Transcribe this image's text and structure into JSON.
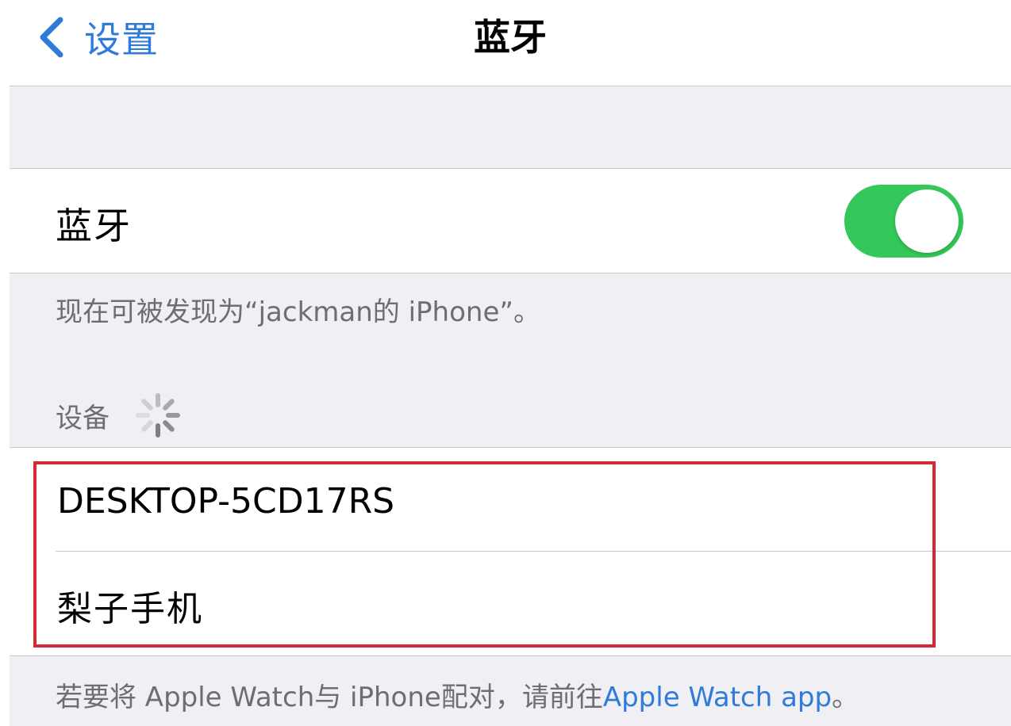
{
  "navbar": {
    "back_label": "设置",
    "title": "蓝牙"
  },
  "bluetooth": {
    "label": "蓝牙",
    "enabled": true,
    "toggle_color": "#34c759",
    "discoverable_text": "现在可被发现为“jackman的 iPhone”。"
  },
  "devices": {
    "header": "设备",
    "items": [
      {
        "name": "DESKTOP-5CD17RS"
      },
      {
        "name": "梨子手机"
      }
    ],
    "highlight_color": "#d32a36"
  },
  "footer": {
    "text": "若要将 Apple Watch与 iPhone配对，请前往",
    "link": "Apple Watch app",
    "suffix": "。"
  },
  "colors": {
    "accent": "#2f7bd8",
    "background": "#efeff4",
    "secondary_text": "#6d6d72"
  }
}
